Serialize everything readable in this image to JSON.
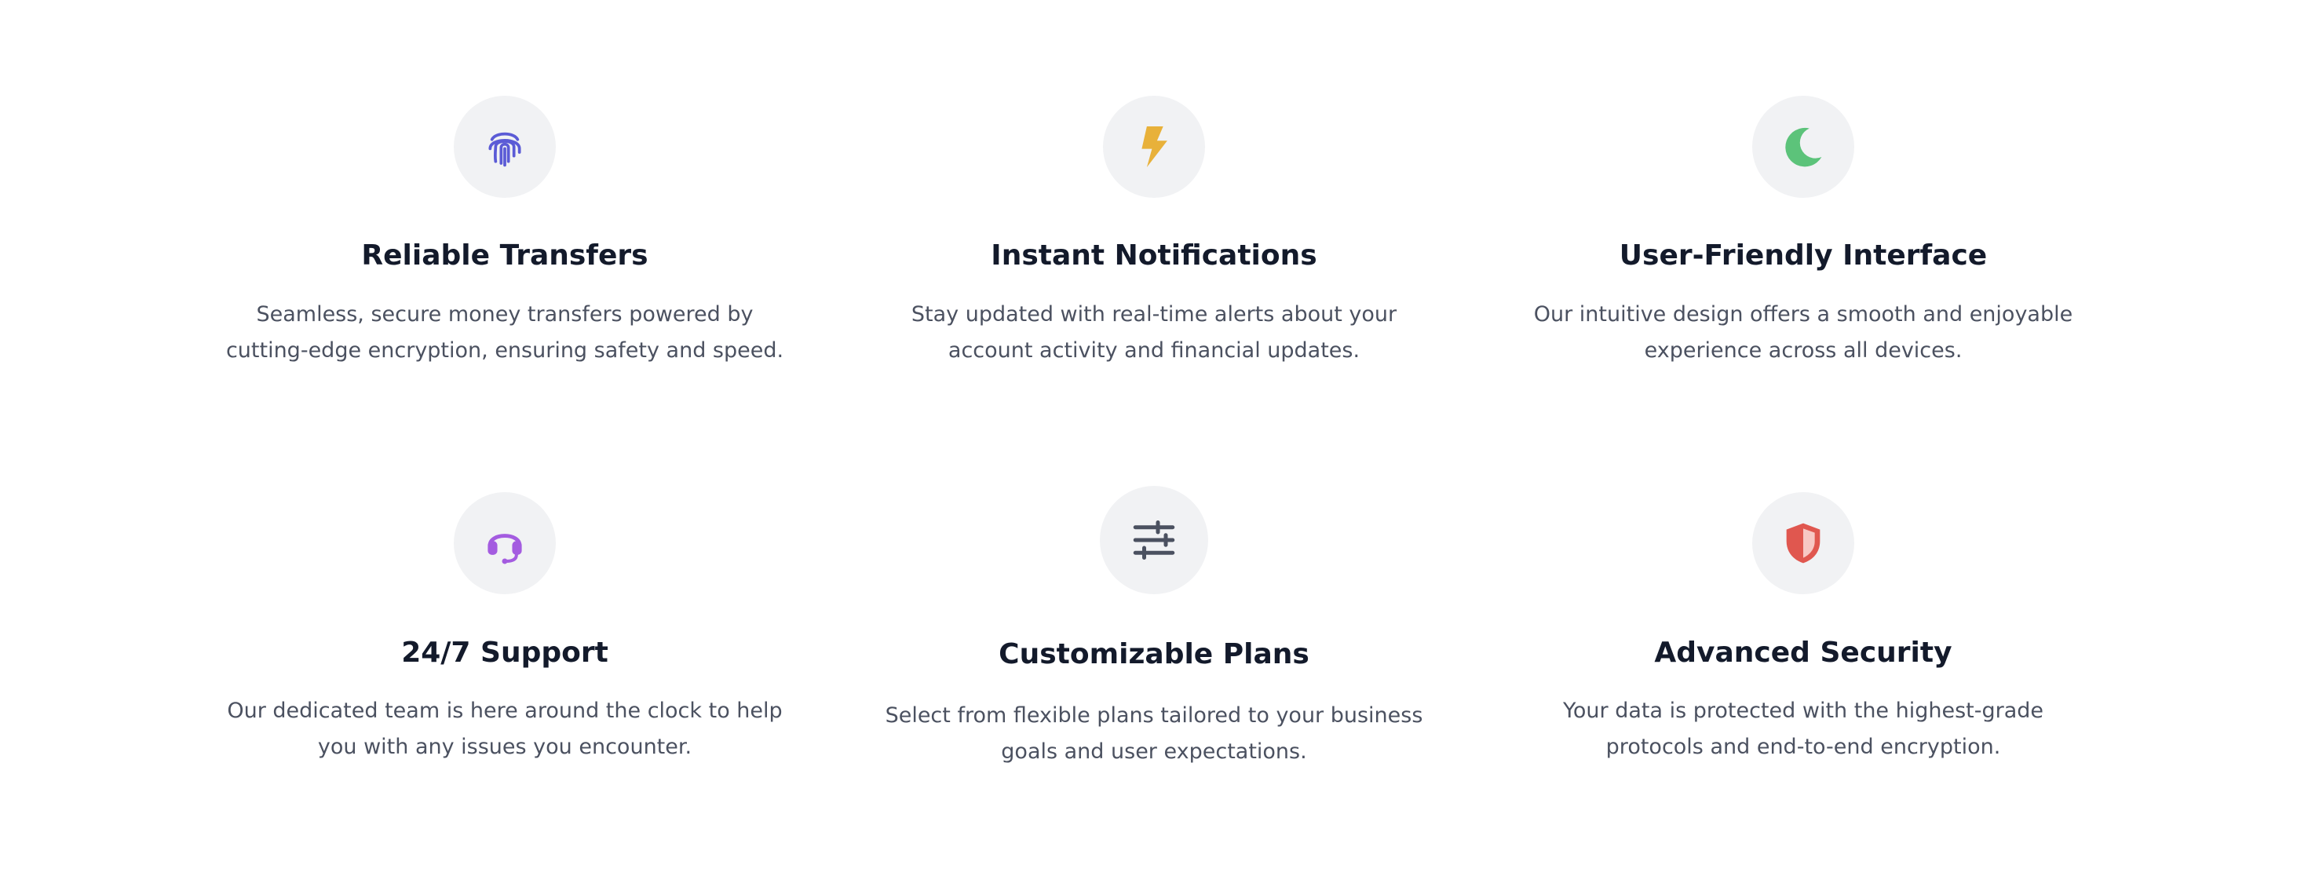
{
  "features": [
    {
      "icon": "fingerprint-icon",
      "icon_color": "#5b5bd6",
      "title": "Reliable Transfers",
      "description": "Seamless, secure money transfers powered by cutting-edge encryption, ensuring safety and speed."
    },
    {
      "icon": "lightning-bolt-icon",
      "icon_color": "#e8b13a",
      "title": "Instant Notifications",
      "description": "Stay updated with real-time alerts about your account activity and financial updates."
    },
    {
      "icon": "crescent-moon-icon",
      "icon_color": "#5cc37a",
      "title": "User-Friendly Interface",
      "description": "Our intuitive design offers a smooth and enjoyable experience across all devices."
    },
    {
      "icon": "headset-icon",
      "icon_color": "#a45ce0",
      "title": "24/7 Support",
      "description": "Our dedicated team is here around the clock to help you with any issues you encounter."
    },
    {
      "icon": "sliders-icon",
      "icon_color": "#4b5160",
      "title": "Customizable Plans",
      "description": "Select from flexible plans tailored to your business goals and user expectations."
    },
    {
      "icon": "shield-icon",
      "icon_color": "#e0574f",
      "title": "Advanced Security",
      "description": "Your data is protected with the highest-grade protocols and end-to-end encryption."
    }
  ]
}
